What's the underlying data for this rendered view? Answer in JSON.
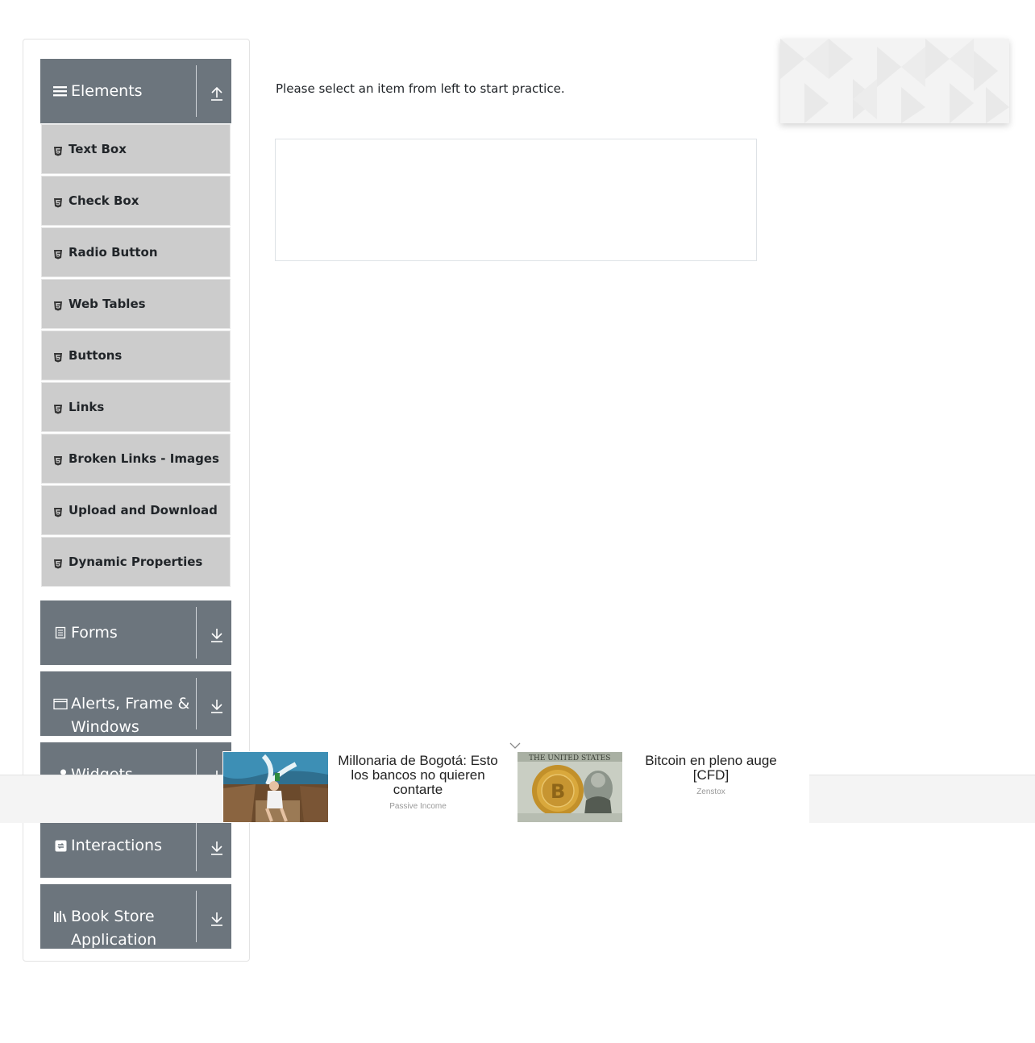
{
  "main": {
    "intro_text": "Please select an item from left to start practice."
  },
  "sidebar": {
    "groups": [
      {
        "title": "Elements",
        "icon": "hamburger-icon",
        "expanded": true,
        "items": [
          {
            "label": "Text Box"
          },
          {
            "label": "Check Box"
          },
          {
            "label": "Radio Button"
          },
          {
            "label": "Web Tables"
          },
          {
            "label": "Buttons"
          },
          {
            "label": "Links"
          },
          {
            "label": "Broken Links - Images"
          },
          {
            "label": "Upload and Download"
          },
          {
            "label": "Dynamic Properties"
          }
        ]
      },
      {
        "title": "Forms",
        "icon": "document-icon",
        "expanded": false
      },
      {
        "title": "Alerts, Frame & Windows",
        "icon": "window-icon",
        "expanded": false
      },
      {
        "title": "Widgets",
        "icon": "widgets-icon",
        "expanded": false
      },
      {
        "title": "Interactions",
        "icon": "interactions-icon",
        "expanded": false
      },
      {
        "title": "Book Store Application",
        "icon": "books-icon",
        "expanded": false
      }
    ]
  },
  "ads": {
    "bottom": [
      {
        "headline": "Millonaria de Bogotá: Esto los bancos no quieren contarte",
        "source": "Passive Income"
      },
      {
        "headline": "Bitcoin en pleno auge [CFD]",
        "source": "Zenstox"
      }
    ]
  },
  "colors": {
    "group_header_bg": "#6c757d",
    "item_bg": "#cccccc",
    "border": "#dee2e6"
  }
}
